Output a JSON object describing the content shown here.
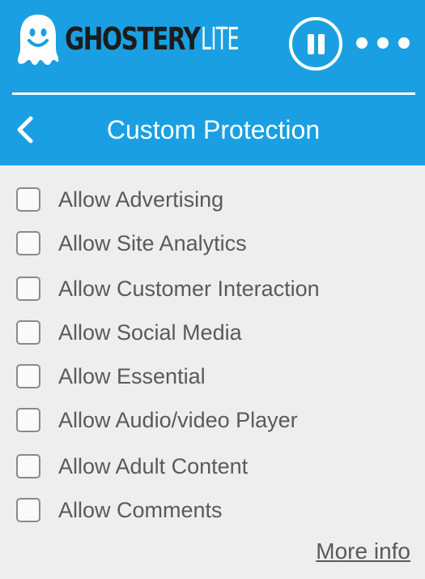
{
  "header": {
    "brand": {
      "main": "GHOSTERY",
      "sub": "LITE"
    },
    "icons": {
      "logo": "ghost-logo-icon",
      "pause": "pause-icon",
      "menu": "more-horizontal-icon",
      "back": "chevron-left-icon"
    },
    "colors": {
      "header_bg": "#1aa0e2",
      "brand_dark": "#1c1c1c",
      "white": "#ffffff"
    },
    "title": "Custom Protection"
  },
  "options": [
    {
      "label": "Allow Advertising",
      "checked": false
    },
    {
      "label": "Allow Site Analytics",
      "checked": false
    },
    {
      "label": "Allow Customer Interaction",
      "checked": false
    },
    {
      "label": "Allow Social Media",
      "checked": false
    },
    {
      "label": "Allow Essential",
      "checked": false
    },
    {
      "label": "Allow Audio/video Player",
      "checked": false
    },
    {
      "label": "Allow Adult Content",
      "checked": false
    },
    {
      "label": "Allow Comments",
      "checked": false
    }
  ],
  "footer": {
    "more_info": "More info"
  }
}
